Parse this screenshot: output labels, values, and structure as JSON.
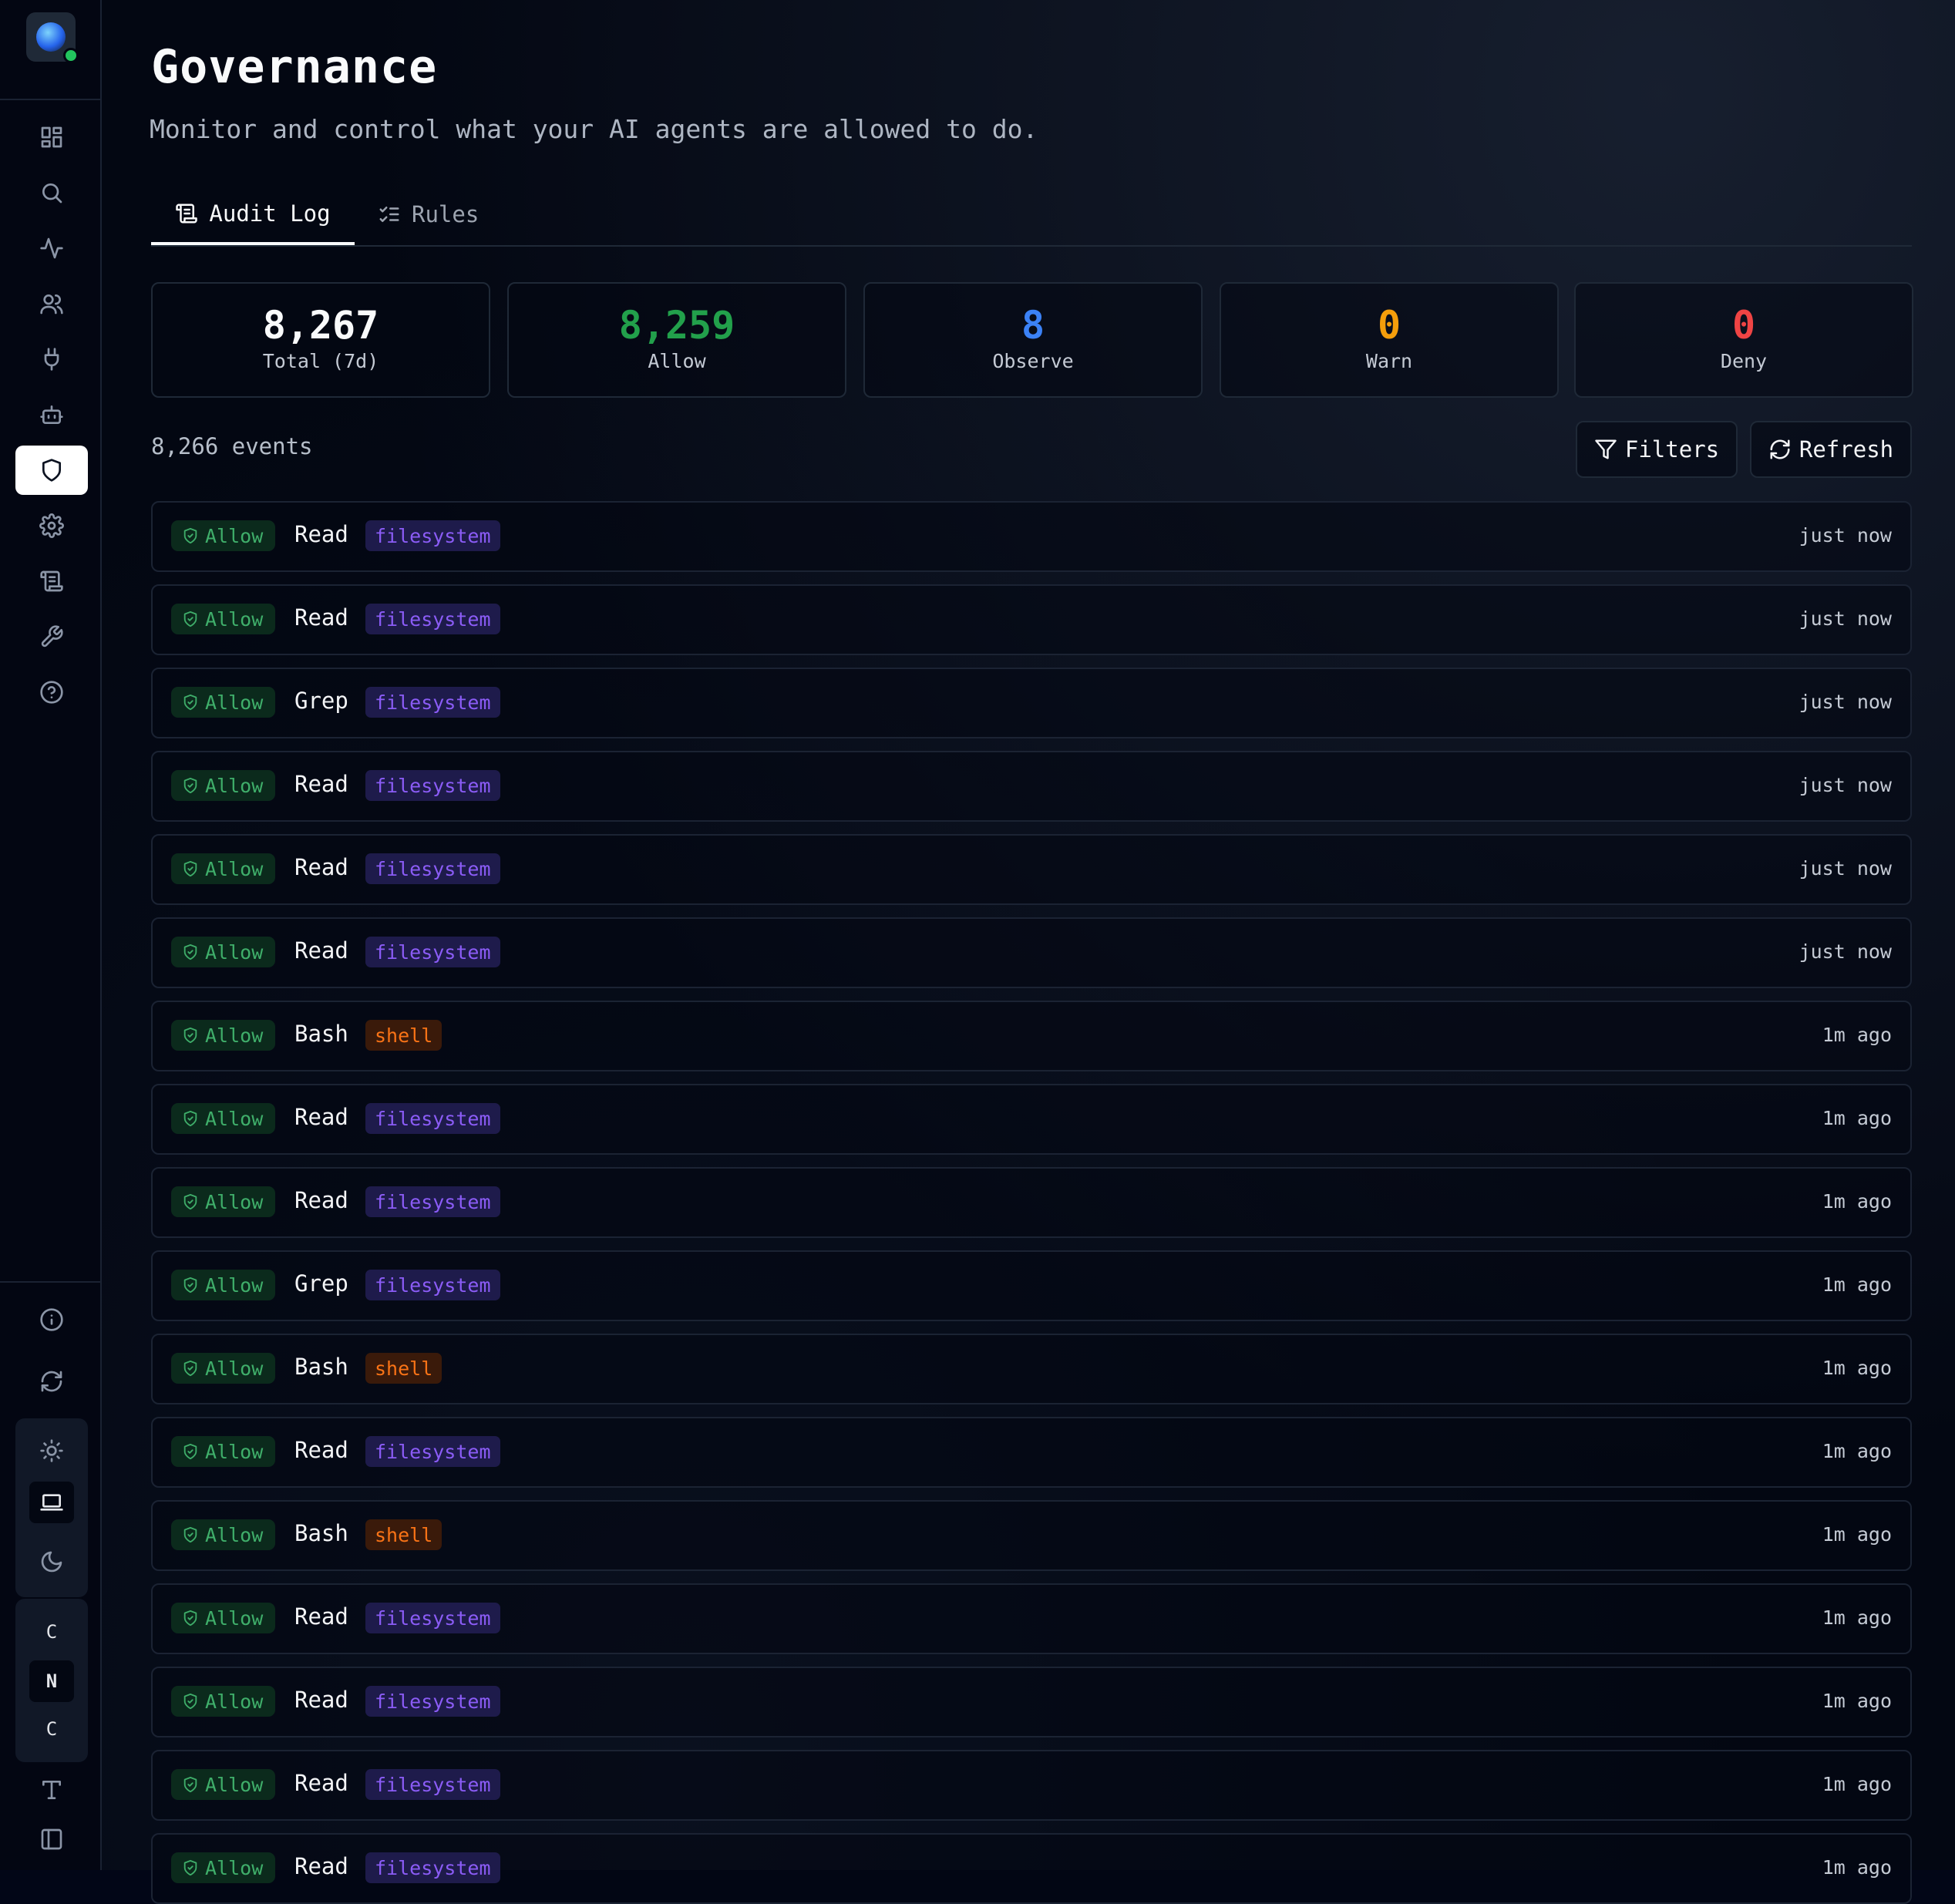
{
  "page": {
    "title": "Governance",
    "subtitle": "Monitor and control what your AI agents are allowed to do."
  },
  "tabs": [
    {
      "label": "Audit Log",
      "icon": "scroll-icon",
      "active": true
    },
    {
      "label": "Rules",
      "icon": "list-checks-icon",
      "active": false
    }
  ],
  "stats": [
    {
      "value": "8,267",
      "label": "Total (7d)",
      "color": "#f9fafb"
    },
    {
      "value": "8,259",
      "label": "Allow",
      "color": "#22a04b"
    },
    {
      "value": "8",
      "label": "Observe",
      "color": "#3b82f6"
    },
    {
      "value": "0",
      "label": "Warn",
      "color": "#f59e0b"
    },
    {
      "value": "0",
      "label": "Deny",
      "color": "#ef4444"
    }
  ],
  "events_count": "8,266 events",
  "toolbar": {
    "filters_label": "Filters",
    "refresh_label": "Refresh"
  },
  "sidebar": {
    "nav": [
      "dashboard-icon",
      "search-icon",
      "activity-icon",
      "users-icon",
      "plug-icon",
      "bot-icon",
      "shield-icon",
      "settings-icon",
      "scroll-icon",
      "wrench-icon",
      "help-icon"
    ],
    "active": "shield-icon",
    "bottom": [
      "info-icon",
      "refresh-icon"
    ],
    "theme": [
      "sun-icon",
      "laptop-icon",
      "moon-icon"
    ],
    "font_options": [
      "C",
      "N",
      "C"
    ],
    "extra": [
      "type-icon",
      "panel-left-icon"
    ]
  },
  "colors": {
    "allow": "#3fae6a",
    "filesystem": "#8b5cf6",
    "shell": "#f97316"
  },
  "events": [
    {
      "decision": "Allow",
      "tool": "Read",
      "category": "filesystem",
      "time": "just now"
    },
    {
      "decision": "Allow",
      "tool": "Read",
      "category": "filesystem",
      "time": "just now"
    },
    {
      "decision": "Allow",
      "tool": "Grep",
      "category": "filesystem",
      "time": "just now"
    },
    {
      "decision": "Allow",
      "tool": "Read",
      "category": "filesystem",
      "time": "just now"
    },
    {
      "decision": "Allow",
      "tool": "Read",
      "category": "filesystem",
      "time": "just now"
    },
    {
      "decision": "Allow",
      "tool": "Read",
      "category": "filesystem",
      "time": "just now"
    },
    {
      "decision": "Allow",
      "tool": "Bash",
      "category": "shell",
      "time": "1m ago"
    },
    {
      "decision": "Allow",
      "tool": "Read",
      "category": "filesystem",
      "time": "1m ago"
    },
    {
      "decision": "Allow",
      "tool": "Read",
      "category": "filesystem",
      "time": "1m ago"
    },
    {
      "decision": "Allow",
      "tool": "Grep",
      "category": "filesystem",
      "time": "1m ago"
    },
    {
      "decision": "Allow",
      "tool": "Bash",
      "category": "shell",
      "time": "1m ago"
    },
    {
      "decision": "Allow",
      "tool": "Read",
      "category": "filesystem",
      "time": "1m ago"
    },
    {
      "decision": "Allow",
      "tool": "Bash",
      "category": "shell",
      "time": "1m ago"
    },
    {
      "decision": "Allow",
      "tool": "Read",
      "category": "filesystem",
      "time": "1m ago"
    },
    {
      "decision": "Allow",
      "tool": "Read",
      "category": "filesystem",
      "time": "1m ago"
    },
    {
      "decision": "Allow",
      "tool": "Read",
      "category": "filesystem",
      "time": "1m ago"
    },
    {
      "decision": "Allow",
      "tool": "Read",
      "category": "filesystem",
      "time": "1m ago"
    }
  ]
}
